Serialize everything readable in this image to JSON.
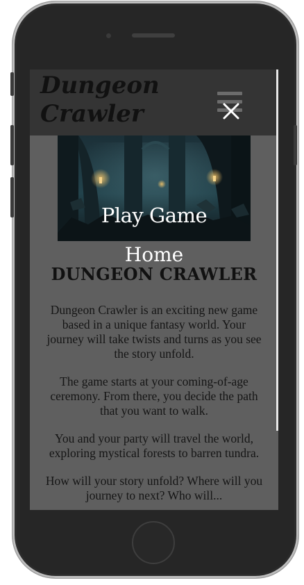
{
  "site": {
    "title": "Dungeon Crawler"
  },
  "nav": {
    "play_label": "Play Game",
    "home_label": "Home"
  },
  "main": {
    "heading": "DUNGEON CRAWLER",
    "paragraphs": [
      "Dungeon Crawler is an exciting new game based in a unique fantasy world. Your journey will take twists and turns as you see the story unfold.",
      "The game starts at your coming-of-age ceremony. From there, you decide the path that you want to walk.",
      "You and your party will travel the world, exploring mystical forests to barren tundra.",
      "How will your story unfold? Where will you journey to next? Who will..."
    ]
  },
  "icons": {
    "menu": "hamburger-icon",
    "close": "close-icon"
  },
  "colors": {
    "header_bg": "#343434",
    "page_bg": "#5f5f5f",
    "text_dark": "#111111",
    "text_light": "#ffffff"
  }
}
